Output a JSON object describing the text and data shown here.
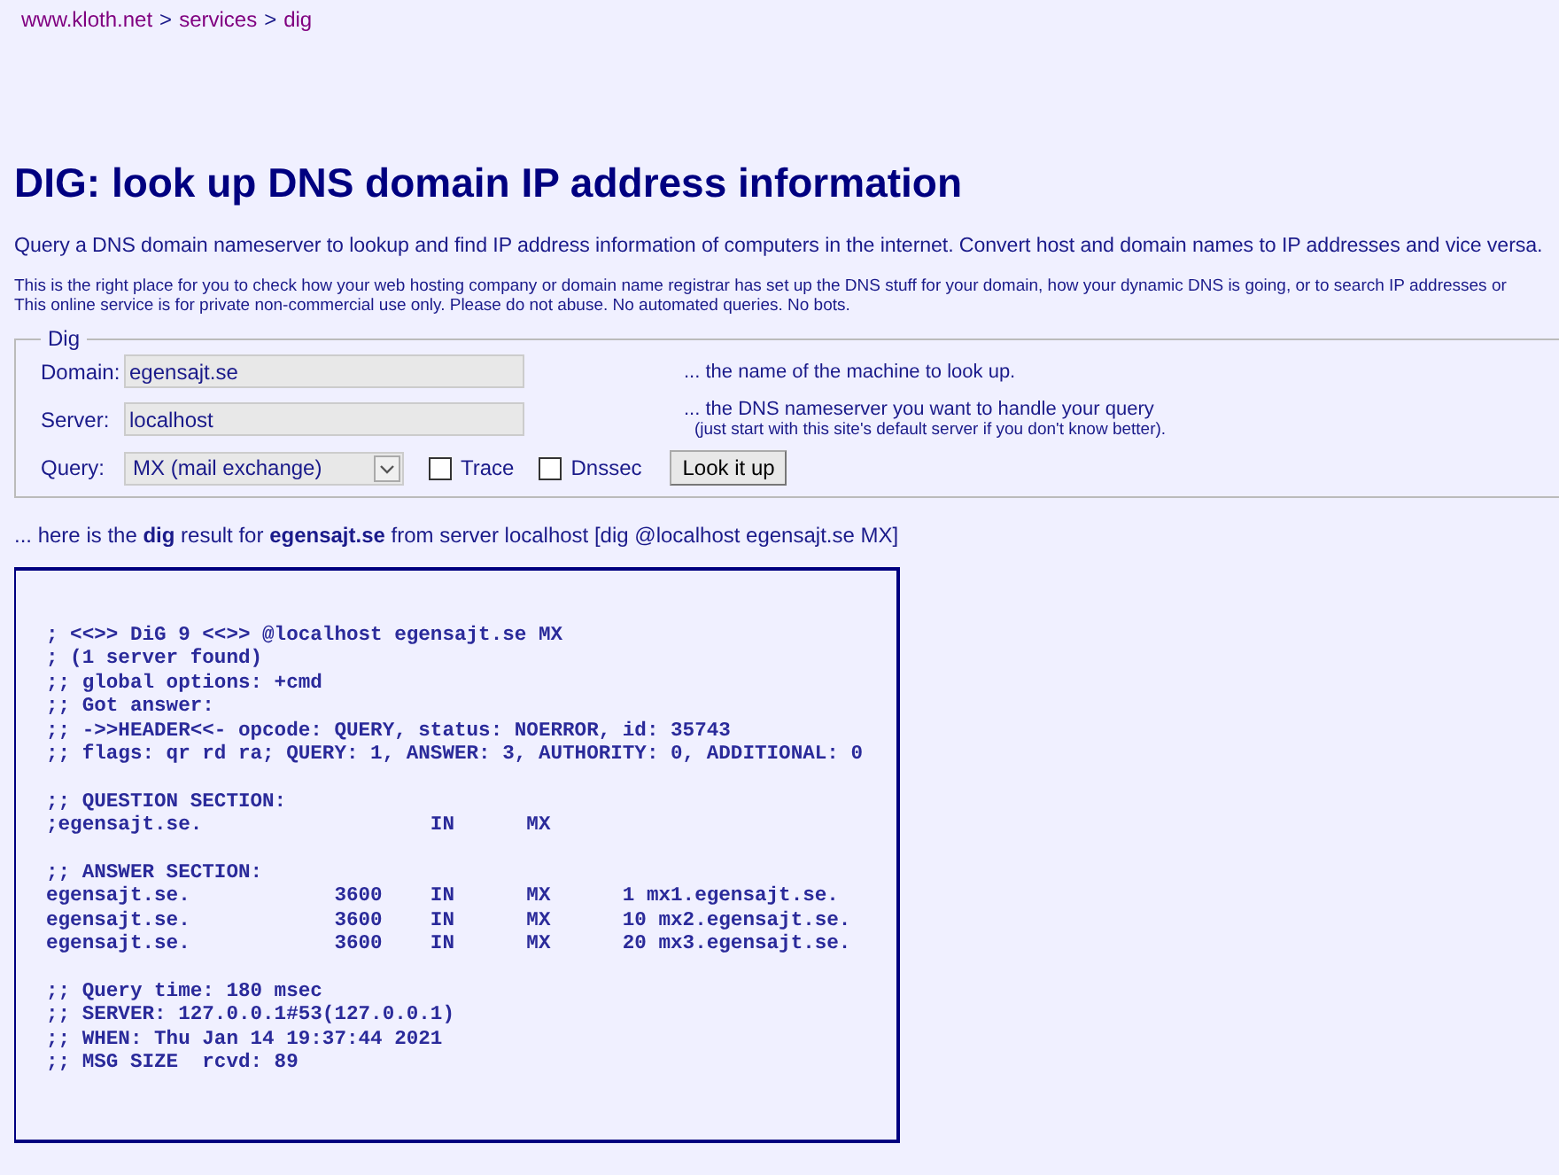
{
  "breadcrumb": [
    "www.kloth.net",
    "services",
    "dig"
  ],
  "breadcrumb_separator": ">",
  "title": "DIG: look up DNS domain IP address information",
  "intro": "Query a DNS domain nameserver to lookup and find IP address information of computers in the internet. Convert host and domain names to IP addresses and vice versa.",
  "notes": [
    "This is the right place for you to check how your web hosting company or domain name registrar has set up the DNS stuff for your domain, how your dynamic DNS is going, or to search IP addresses or",
    "This online service is for private non-commercial use only. Please do not abuse. No automated queries. No bots."
  ],
  "form": {
    "legend": "Dig",
    "domain": {
      "label": "Domain:",
      "value": "egensajt.se",
      "hint": "... the name of the machine to look up."
    },
    "server": {
      "label": "Server:",
      "value": "localhost",
      "hint": "... the DNS nameserver you want to handle your query",
      "subhint": "(just start with this site's default server if you don't know better)."
    },
    "query": {
      "label": "Query:",
      "value": "MX (mail exchange)"
    },
    "options": [
      {
        "label": "Trace",
        "checked": false
      },
      {
        "label": "Dnssec",
        "checked": false
      }
    ],
    "button": "Look it up"
  },
  "result_intro": "... here is the **dig** result for **egensajt.se** from server localhost [dig @localhost egensajt.se MX]",
  "output": [
    {
      "lines": [
        "; <<>> DiG 9 <<>> @localhost egensajt.se MX",
        "; (1 server found)",
        ";; global options: +cmd",
        ";; Got answer:",
        ";; ->>HEADER<<- opcode: QUERY, status: NOERROR, id: 35743",
        ";; flags: qr rd ra; QUERY: 1, ANSWER: 3, AUTHORITY: 0, ADDITIONAL: 0"
      ]
    },
    {
      "lines": [
        ";; QUESTION SECTION:",
        ";egensajt.se.                   IN      MX"
      ]
    },
    {
      "lines": [
        ";; ANSWER SECTION:",
        "egensajt.se.            3600    IN      MX      1 mx1.egensajt.se.",
        "egensajt.se.            3600    IN      MX      10 mx2.egensajt.se.",
        "egensajt.se.            3600    IN      MX      20 mx3.egensajt.se."
      ]
    },
    {
      "lines": [
        ";; Query time: 180 msec",
        ";; SERVER: 127.0.0.1#53(127.0.0.1)",
        ";; WHEN: Thu Jan 14 19:37:44 2021",
        ";; MSG SIZE  rcvd: 89"
      ]
    }
  ]
}
